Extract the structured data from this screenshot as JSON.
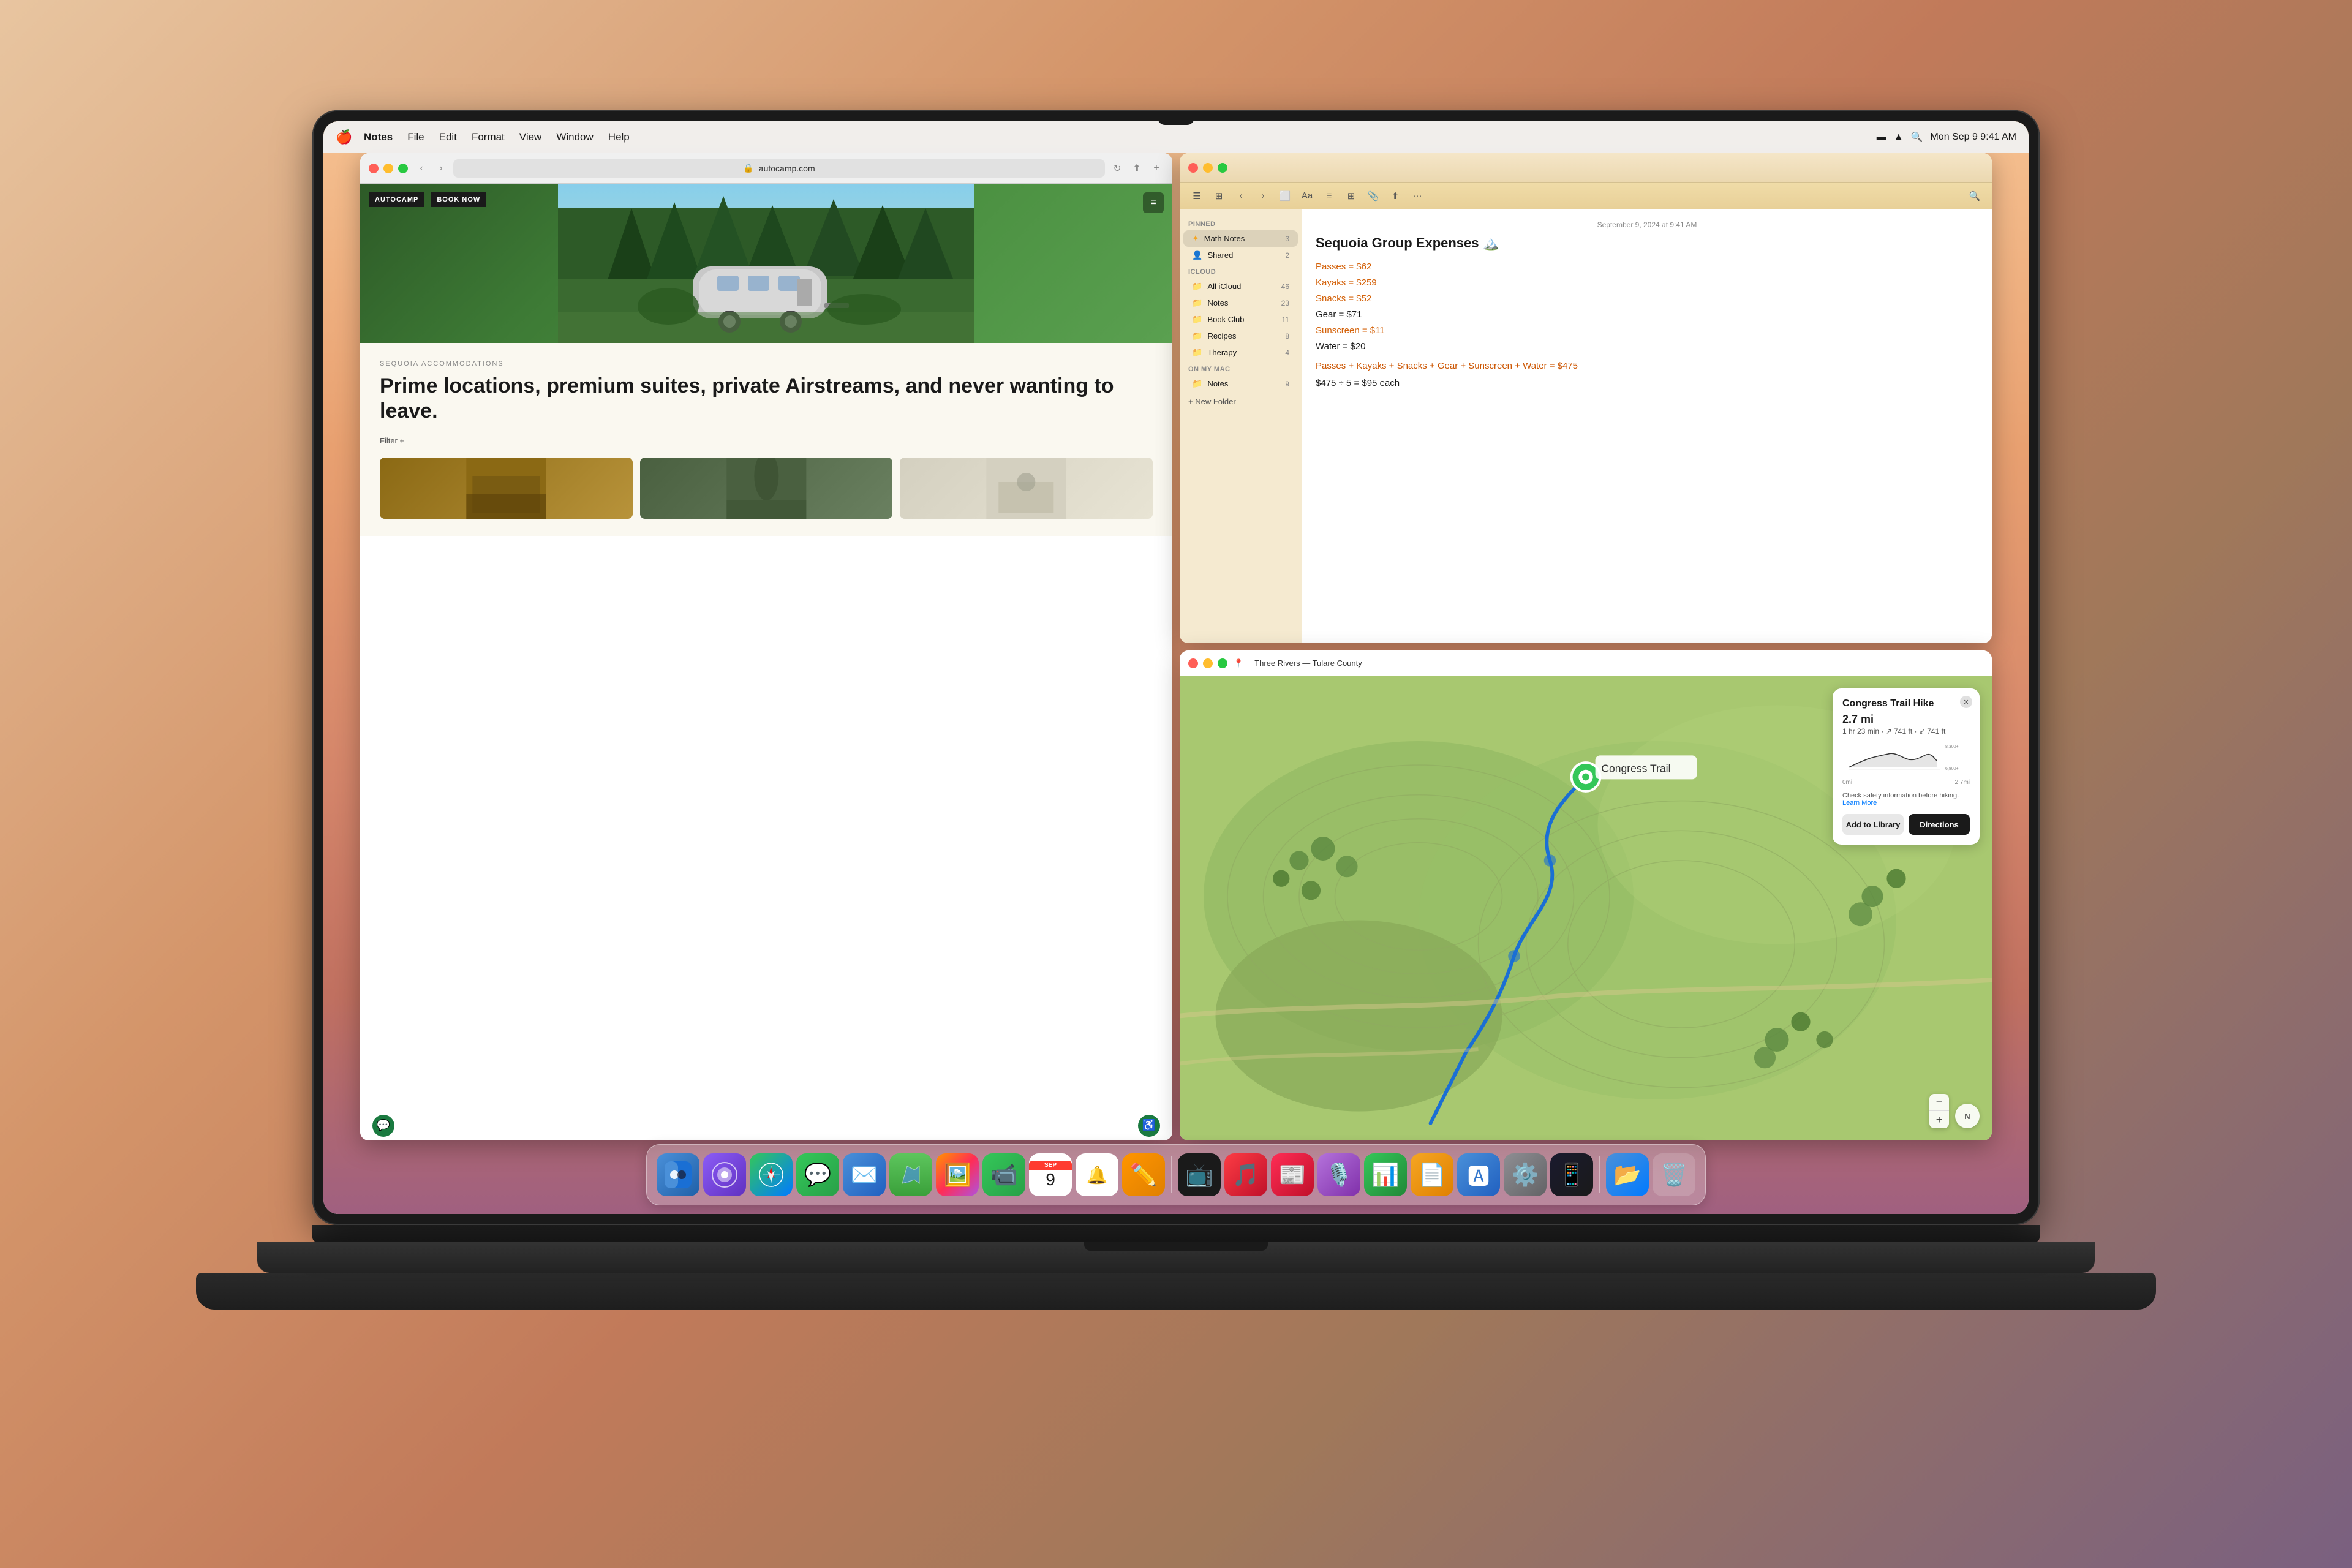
{
  "menubar": {
    "apple_symbol": "🍎",
    "app_name": "Notes",
    "menu_items": [
      "Notes",
      "File",
      "Edit",
      "Format",
      "View",
      "Window",
      "Help"
    ],
    "right_items": {
      "battery": "—",
      "wifi": "WiFi",
      "search": "🔍",
      "time": "Mon Sep 9  9:41 AM"
    }
  },
  "safari": {
    "url": "autocamp.com",
    "logo": "AUTOCAMP",
    "book_now": "BOOK NOW",
    "section_label": "SEQUOIA ACCOMMODATIONS",
    "headline": "Prime locations, premium suites, private Airstreams, and never wanting to leave.",
    "filter": "Filter +",
    "bottom_icons": {
      "chat": "💬",
      "accessibility": "♿"
    }
  },
  "notes": {
    "titlebar": {
      "traffic_red": "#ff5f57",
      "traffic_yellow": "#ffbd2e",
      "traffic_green": "#28c941"
    },
    "toolbar_icons": [
      "list",
      "grid",
      "back",
      "forward",
      "box",
      "Aa",
      "list2",
      "table",
      "grid2",
      "share",
      "more",
      "search"
    ],
    "sidebar": {
      "pinned_section": "PINNED",
      "folders": [
        {
          "name": "Math Notes",
          "count": "3",
          "icon": "✦"
        },
        {
          "name": "Shared",
          "count": "2",
          "icon": "👤"
        }
      ],
      "icloud_section": "iCloud",
      "icloud_folders": [
        {
          "name": "All iCloud",
          "count": "46",
          "icon": "📁"
        },
        {
          "name": "Notes",
          "count": "23",
          "icon": "📁"
        },
        {
          "name": "Book Club",
          "count": "11",
          "icon": "📁"
        },
        {
          "name": "Recipes",
          "count": "8",
          "icon": "📁"
        },
        {
          "name": "Therapy",
          "count": "4",
          "icon": "📁"
        }
      ],
      "onmymac_section": "On My Mac",
      "onmymac_folders": [
        {
          "name": "Notes",
          "count": "9",
          "icon": "📁"
        }
      ],
      "new_folder": "+ New Folder"
    },
    "content": {
      "date": "September 9, 2024 at 9:41 AM",
      "title": "Sequoia Group Expenses 🏔️",
      "lines": [
        {
          "text": "Passes = $62",
          "color": "orange"
        },
        {
          "text": "Kayaks = $259",
          "color": "orange"
        },
        {
          "text": "Snacks = $52",
          "color": "orange"
        },
        {
          "text": "Gear = $71",
          "color": "plain"
        },
        {
          "text": "Sunscreen = $11",
          "color": "orange"
        },
        {
          "text": "Water = $20",
          "color": "plain"
        }
      ],
      "calc_line": "Passes + Kayaks + Snacks + Gear + Sunscreen + Water = $475",
      "result_line": "$475 ÷ 5 = $95 each"
    }
  },
  "maps": {
    "titlebar": {
      "location": "Three Rivers — Tulare County"
    },
    "hike_card": {
      "title": "Congress Trail Hike",
      "distance": "2.7 mi",
      "time": "1 hr 23 min",
      "gain": "741 ft",
      "loss": "741 ft",
      "chart_y_max": "8,300+",
      "chart_y_min": "6,800+",
      "chart_x_start": "0mi",
      "chart_x_end": "2.7mi",
      "warning": "Check safety information before hiking.",
      "learn_more": "Learn More",
      "btn_library": "Add to Library",
      "btn_directions": "Directions",
      "compass": "N",
      "zoom_plus": "+",
      "zoom_minus": "−"
    }
  },
  "dock": {
    "apps": [
      {
        "id": "finder",
        "label": "Finder",
        "emoji": "🔵",
        "class": "dock-finder"
      },
      {
        "id": "launchpad",
        "label": "Launchpad",
        "emoji": "🚀",
        "class": "dock-launchpad"
      },
      {
        "id": "safari",
        "label": "Safari",
        "emoji": "🧭",
        "class": "dock-safari-icon"
      },
      {
        "id": "messages",
        "label": "Messages",
        "emoji": "💬",
        "class": "dock-messages"
      },
      {
        "id": "mail",
        "label": "Mail",
        "emoji": "✉️",
        "class": "dock-mail"
      },
      {
        "id": "maps",
        "label": "Maps",
        "emoji": "🗺️",
        "class": "dock-maps"
      },
      {
        "id": "photos",
        "label": "Photos",
        "emoji": "🖼️",
        "class": "dock-photos"
      },
      {
        "id": "facetime",
        "label": "FaceTime",
        "emoji": "📹",
        "class": "dock-facetime"
      },
      {
        "id": "calendar",
        "label": "Calendar",
        "emoji": "📅",
        "class": "dock-calendar"
      },
      {
        "id": "reminders",
        "label": "Reminders",
        "emoji": "🔔",
        "class": "dock-reminders"
      },
      {
        "id": "freeform",
        "label": "Freeform",
        "emoji": "✏️",
        "class": "dock-freeform"
      },
      {
        "id": "appletv",
        "label": "Apple TV",
        "emoji": "📺",
        "class": "dock-appletv"
      },
      {
        "id": "music",
        "label": "Music",
        "emoji": "🎵",
        "class": "dock-music"
      },
      {
        "id": "news",
        "label": "News",
        "emoji": "📰",
        "class": "dock-news"
      },
      {
        "id": "podcasts",
        "label": "Podcasts",
        "emoji": "🎙️",
        "class": "dock-podcasts"
      },
      {
        "id": "numbers",
        "label": "Numbers",
        "emoji": "📊",
        "class": "dock-numbers"
      },
      {
        "id": "pages",
        "label": "Pages",
        "emoji": "📄",
        "class": "dock-pages"
      },
      {
        "id": "appstore",
        "label": "App Store",
        "emoji": "🅰",
        "class": "dock-appstore"
      },
      {
        "id": "settings",
        "label": "System Settings",
        "emoji": "⚙️",
        "class": "dock-settings"
      },
      {
        "id": "iphone",
        "label": "iPhone Mirroring",
        "emoji": "📱",
        "class": "dock-iphone"
      },
      {
        "id": "files",
        "label": "Files",
        "emoji": "📂",
        "class": "dock-files"
      },
      {
        "id": "trash",
        "label": "Trash",
        "emoji": "🗑️",
        "class": "dock-trash"
      }
    ]
  }
}
